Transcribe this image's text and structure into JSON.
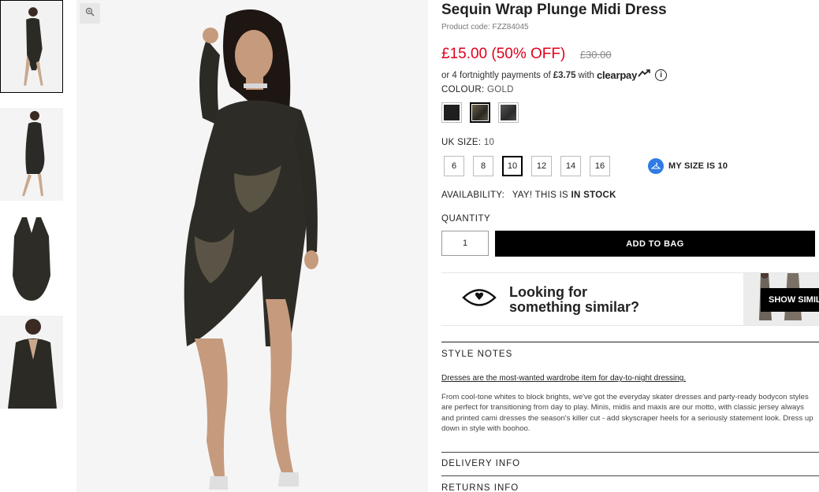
{
  "product": {
    "title": "Sequin Wrap Plunge Midi Dress",
    "product_code": "Product code: FZZ84045",
    "price_now": "£15.00 (50% OFF)",
    "price_was": "£30.00"
  },
  "clearpay": {
    "prefix": "or 4 fortnightly payments of",
    "amount": "£3.75",
    "with": "with",
    "logo": "clearpay",
    "info": "i"
  },
  "colour": {
    "label": "COLOUR:",
    "value": "GOLD",
    "swatches": [
      {
        "name": "black",
        "color": "#1f1f1f"
      },
      {
        "name": "gold",
        "color": "#4a4336"
      },
      {
        "name": "silver",
        "color": "#3a3a3a"
      }
    ]
  },
  "size": {
    "label": "UK SIZE:",
    "value": "10",
    "options": [
      "6",
      "8",
      "10",
      "12",
      "14",
      "16"
    ],
    "my_size": "MY SIZE IS 10"
  },
  "availability": {
    "label": "AVAILABILITY:",
    "text": "YAY! THIS IS",
    "status": "IN STOCK"
  },
  "quantity": {
    "label": "QUANTITY",
    "value": "1"
  },
  "add_to_bag": "ADD TO BAG",
  "similar": {
    "line1": "Looking for",
    "line2": "something similar?",
    "button": "SHOW SIMILAR"
  },
  "style_notes": {
    "heading": "STYLE NOTES",
    "link": "Dresses are the most-wanted wardrobe item for day-to-night dressing.",
    "lines": [
      "From cool-tone whites to block brights, we've got the everyday skater dresses and party-ready bodycon styles",
      "are perfect for transitioning from day to play. Minis, midis and maxis are our motto, with classic jersey always",
      "and printed cami dresses the season's killer cut - add skyscraper heels for a seriously statement look. Dress up",
      "down in style with boohoo."
    ]
  },
  "delivery_info": "DELIVERY INFO",
  "returns_info": "RETURNS INFO",
  "colors": {
    "price": "#e0001b",
    "button": "#000000",
    "my_size_icon": "#2f7be5"
  }
}
